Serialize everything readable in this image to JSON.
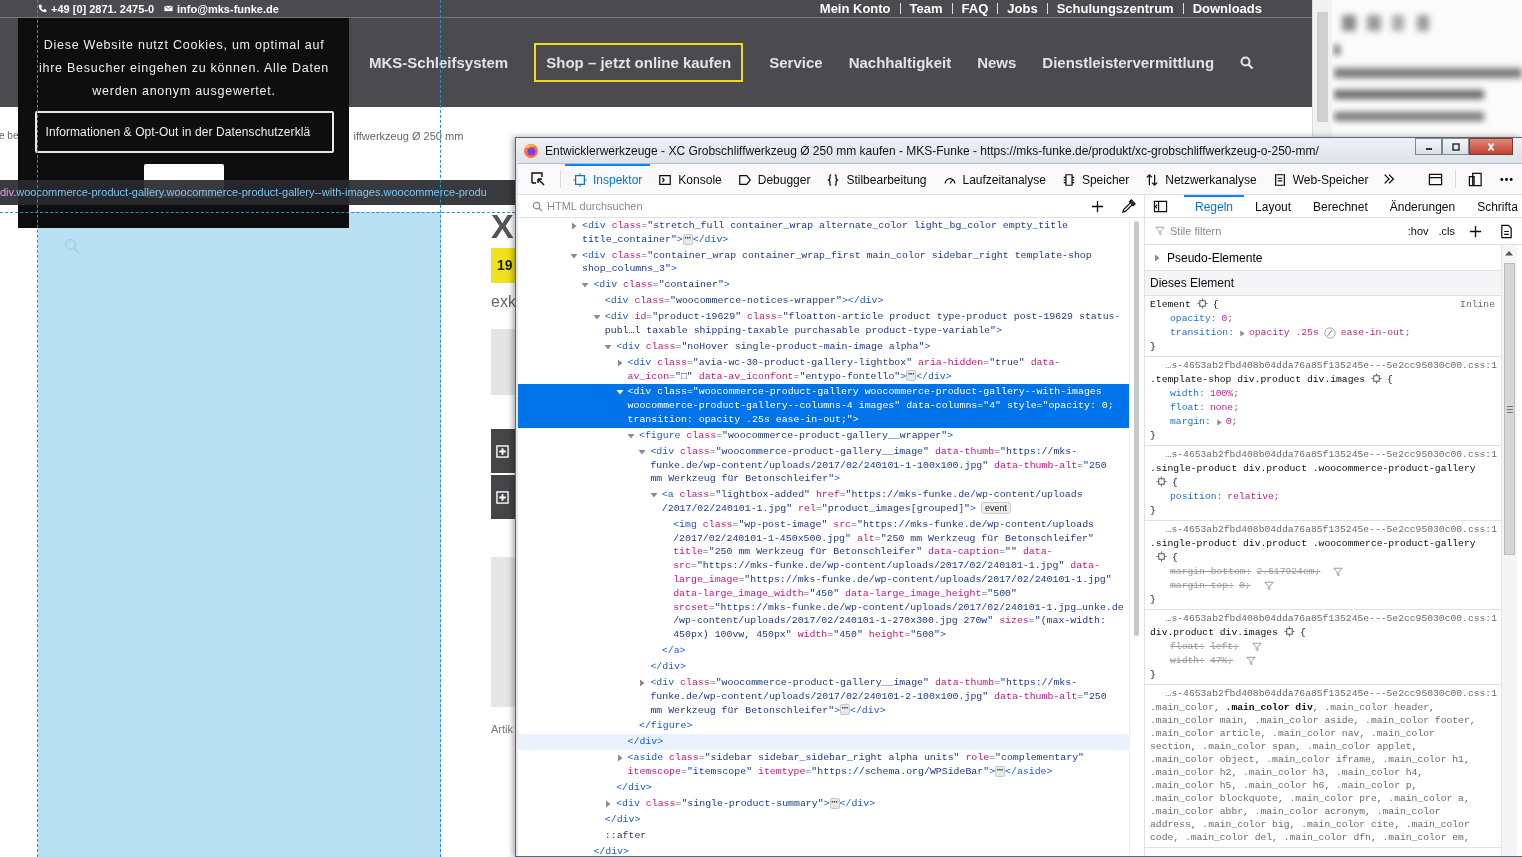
{
  "page": {
    "contact": [
      {
        "kind": "phone",
        "text": "+49 [0] 2871. 2475-0"
      },
      {
        "kind": "mail",
        "text": "info@mks-funke.de"
      }
    ],
    "top_links": [
      "Mein Konto",
      "Team",
      "FAQ",
      "Jobs",
      "Schulungszentrum",
      "Downloads"
    ],
    "nav": [
      {
        "label": "MKS-Schleifsystem",
        "highlighted": false
      },
      {
        "label": "Shop – jetzt online kaufen",
        "highlighted": true
      },
      {
        "label": "Service",
        "highlighted": false
      },
      {
        "label": "Nachhaltigkeit",
        "highlighted": false
      },
      {
        "label": "News",
        "highlighted": false
      },
      {
        "label": "Dienstleistervermittlung",
        "highlighted": false
      }
    ],
    "breadcrumb_parts": [
      "e be",
      "iffwerkzeug Ø 250 mm"
    ],
    "product_fragments": {
      "title": "X",
      "price": "19",
      "subtitle": "exk",
      "sku": "Artik"
    }
  },
  "cookie_banner": {
    "text": "Diese Website nutzt Cookies, um optimal auf ihre Besucher eingehen zu können. Alle Daten werden anonym ausgewertet.",
    "info_button": "Informationen & Opt-Out in der Datenschutzerklä"
  },
  "highlight_tooltip": {
    "tag": "div",
    "classes": ".woocommerce-product-gallery.woocommerce-product-gallery--with-images.woocommerce-produ"
  },
  "devtools": {
    "title": "Entwicklerwerkzeuge - XC Grobschliffwerkzeug Ø 250 mm kaufen - MKS-Funke - https://mks-funke.de/produkt/xc-grobschliffwerkzeug-o-250-mm/",
    "tools": [
      {
        "label": "Inspektor",
        "selected": true
      },
      {
        "label": "Konsole",
        "selected": false
      },
      {
        "label": "Debugger",
        "selected": false
      },
      {
        "label": "Stilbearbeitung",
        "selected": false
      },
      {
        "label": "Laufzeitanalyse",
        "selected": false
      },
      {
        "label": "Speicher",
        "selected": false
      },
      {
        "label": "Netzwerkanalyse",
        "selected": false
      },
      {
        "label": "Web-Speicher",
        "selected": false
      }
    ],
    "markup_search": {
      "placeholder": "HTML durchsuchen"
    },
    "tree": [
      {
        "lines": [
          "<div class=\"stretch_full container_wrap alternate_color light_bg_color empty_title",
          "title_container\">⋯</div>"
        ],
        "expanded": false,
        "selected": false
      },
      {
        "lines": [
          "<div class=\"container_wrap container_wrap_first main_color sidebar_right template-shop",
          "shop_columns_3\">"
        ],
        "expanded": true,
        "selected": false,
        "children": [
          {
            "lines": [
              "<div class=\"container\">"
            ],
            "expanded": true,
            "selected": false,
            "close": "</div>",
            "close_hovered": false,
            "children": [
              {
                "lines": [
                  "<div class=\"woocommerce-notices-wrapper\"></div>"
                ],
                "selected": false
              },
              {
                "lines": [
                  "<div id=\"product-19629\" class=\"floatton-article product type-product post-19629 status-",
                  "publ…l taxable shipping-taxable purchasable product-type-variable\">"
                ],
                "expanded": true,
                "selected": false,
                "close": "</div>",
                "close_hovered": false,
                "children": [
                  {
                    "lines": [
                      "<div class=\"noHover single-product-main-image alpha\">"
                    ],
                    "expanded": true,
                    "selected": false,
                    "close": "</div>",
                    "close_hovered": false,
                    "children": [
                      {
                        "lines": [
                          "<div class=\"avia-wc-30-product-gallery-lightbox\" aria-hidden=\"true\" data-",
                          "av_icon=\"□\" data-av_iconfont=\"entypo-fontello\">⋯</div>"
                        ],
                        "expanded": false,
                        "selected": false
                      },
                      {
                        "lines": [
                          "<div class=\"woocommerce-product-gallery woocommerce-product-gallery--with-images",
                          "woocommerce-product-gallery--columns-4 images\" data-columns=\"4\" style=\"opacity: 0;",
                          "transition: opacity .25s ease-in-out;\">"
                        ],
                        "expanded": true,
                        "selected": true,
                        "close": "</div>",
                        "close_hovered": true,
                        "children": [
                          {
                            "lines": [
                              "<figure class=\"woocommerce-product-gallery__wrapper\">"
                            ],
                            "expanded": true,
                            "selected": false,
                            "close": "</figure>",
                            "close_hovered": false,
                            "children": [
                              {
                                "lines": [
                                  "<div class=\"woocommerce-product-gallery__image\" data-thumb=\"https://mks-",
                                  "funke.de/wp-content/uploads/2017/02/240101-1-100x100.jpg\" data-thumb-alt=\"250",
                                  "mm Werkzeug für Betonschleifer\">"
                                ],
                                "expanded": true,
                                "selected": false,
                                "close": "</div>",
                                "close_hovered": false,
                                "children": [
                                  {
                                    "lines": [
                                      "<a class=\"lightbox-added\" href=\"https://mks-funke.de/wp-content/uploads",
                                      "/2017/02/240101-1.jpg\" rel=\"product_images[grouped]\">"
                                    ],
                                    "badge": "event",
                                    "expanded": true,
                                    "selected": false,
                                    "close": "</a>",
                                    "close_hovered": false,
                                    "children": [
                                      {
                                        "lines": [
                                          "<img class=\"wp-post-image\" src=\"https://mks-funke.de/wp-content/uploads",
                                          "/2017/02/240101-1-450x500.jpg\" alt=\"250 mm Werkzeug für Betonschleifer\"",
                                          "title=\"250 mm Werkzeug für Betonschleifer\" data-caption=\"\" data-",
                                          "src=\"https://mks-funke.de/wp-content/uploads/2017/02/240101-1.jpg\" data-",
                                          "large_image=\"https://mks-funke.de/wp-content/uploads/2017/02/240101-1.jpg\"",
                                          "data-large_image_width=\"450\" data-large_image_height=\"500\"",
                                          "srcset=\"https://mks-funke.de/wp-content/uploads/2017/02/240101-1.jpg…unke.de",
                                          "/wp-content/uploads/2017/02/240101-1-270x300.jpg 270w\" sizes=\"(max-width:",
                                          "450px) 100vw, 450px\" width=\"450\" height=\"500\">"
                                        ],
                                        "selected": false
                                      }
                                    ]
                                  }
                                ]
                              },
                              {
                                "lines": [
                                  "<div class=\"woocommerce-product-gallery__image\" data-thumb=\"https://mks-",
                                  "funke.de/wp-content/uploads/2017/02/240101-2-100x100.jpg\" data-thumb-alt=\"250",
                                  "mm Werkzeug für Betonschleifer\">⋯</div>"
                                ],
                                "expanded": false,
                                "selected": false
                              }
                            ]
                          }
                        ]
                      },
                      {
                        "lines": [
                          "<aside class=\"sidebar sidebar_sidebar_right alpha units\" role=\"complementary\"",
                          "itemscope=\"itemscope\" itemtype=\"https://schema.org/WPSideBar\">⋯</aside>"
                        ],
                        "expanded": false,
                        "selected": false
                      }
                    ]
                  },
                  {
                    "lines": [
                      "<div class=\"single-product-summary\">⋯</div>"
                    ],
                    "expanded": false,
                    "selected": false
                  }
                ]
              },
              {
                "lines": [
                  "::after"
                ],
                "selected": false
              }
            ]
          }
        ]
      }
    ],
    "sidebar_tabs": [
      {
        "label": "Regeln",
        "selected": true
      },
      {
        "label": "Layout",
        "selected": false
      },
      {
        "label": "Berechnet",
        "selected": false
      },
      {
        "label": "Änderungen",
        "selected": false
      },
      {
        "label": "Schrifta",
        "selected": false
      }
    ],
    "rules_filter": {
      "placeholder": "Stile filtern",
      "hov": ":hov",
      "cls": ".cls"
    },
    "pseudo_elements": "Pseudo-Elemente",
    "section": "Dieses Element",
    "rules": [
      {
        "origin": "Inline",
        "selector": [
          "Element"
        ],
        "partial_match": false,
        "gear": true,
        "brace": "{",
        "close": "}",
        "decls": [
          {
            "prop": "opacity:",
            "value": "0;",
            "expandable": false,
            "overridden": false
          },
          {
            "prop": "transition:",
            "value": "opacity .25s",
            "timing": "ease-in-out;",
            "expandable": true,
            "overridden": false
          }
        ]
      },
      {
        "source": "…s-4653ab2fbd408b04dda76a85f135245e---5e2cc95030c00.css:1",
        "selector": [
          ".template-shop div.product div.images"
        ],
        "partial_match": false,
        "gear": true,
        "brace": "{",
        "close": "}",
        "decls": [
          {
            "prop": "width:",
            "value": "100%;",
            "expandable": false,
            "overridden": false
          },
          {
            "prop": "float:",
            "value": "none;",
            "expandable": false,
            "overridden": false
          },
          {
            "prop": "margin:",
            "value": "0;",
            "expandable": true,
            "overridden": false
          }
        ]
      },
      {
        "source": "…s-4653ab2fbd408b04dda76a85f135245e---5e2cc95030c00.css:1",
        "selector": [
          ".single-product div.product .woocommerce-product-gallery"
        ],
        "partial_match": false,
        "gear": true,
        "brace": "{",
        "close": "}",
        "decls": [
          {
            "prop": "position:",
            "value": "relative;",
            "expandable": false,
            "overridden": false
          }
        ]
      },
      {
        "source": "…s-4653ab2fbd408b04dda76a85f135245e---5e2cc95030c00.css:1",
        "selector": [
          ".single-product div.product .woocommerce-product-gallery"
        ],
        "partial_match": false,
        "gear": true,
        "brace": "{",
        "close": "}",
        "decls": [
          {
            "prop": "margin-bottom:",
            "value": "2.617924em;",
            "expandable": false,
            "overridden": true
          },
          {
            "prop": "margin-top:",
            "value": "0;",
            "expandable": false,
            "overridden": true
          }
        ]
      },
      {
        "source": "…s-4653ab2fbd408b04dda76a85f135245e---5e2cc95030c00.css:1",
        "selector": [
          "div.product div.images"
        ],
        "partial_match": false,
        "gear": true,
        "brace": "{",
        "close": "}",
        "decls": [
          {
            "prop": "float:",
            "value": "left;",
            "expandable": false,
            "overridden": true
          },
          {
            "prop": "width:",
            "value": "47%;",
            "expandable": false,
            "overridden": true
          }
        ]
      },
      {
        "source": "…s-4653ab2fbd408b04dda76a85f135245e---5e2cc95030c00.css:1",
        "selector": [
          ".main_color, **.main_color div**, .main_color header,",
          ".main_color main, .main_color aside, .main_color footer,",
          ".main_color article, .main_color nav, .main_color",
          "section, .main_color span, .main_color applet,",
          ".main_color object, .main_color iframe, .main_color h1,",
          ".main_color h2, .main_color h3, .main_color h4,",
          ".main_color h5, .main_color h6, .main_color p,",
          ".main_color blockquote, .main_color pre, .main_color a,",
          ".main_color abbr, .main_color acronym, .main_color",
          "address, .main_color big, .main_color cite, .main_color",
          "code, .main_color del, .main_color dfn, .main_color em,"
        ],
        "partial_match": true,
        "gear": false
      }
    ]
  }
}
